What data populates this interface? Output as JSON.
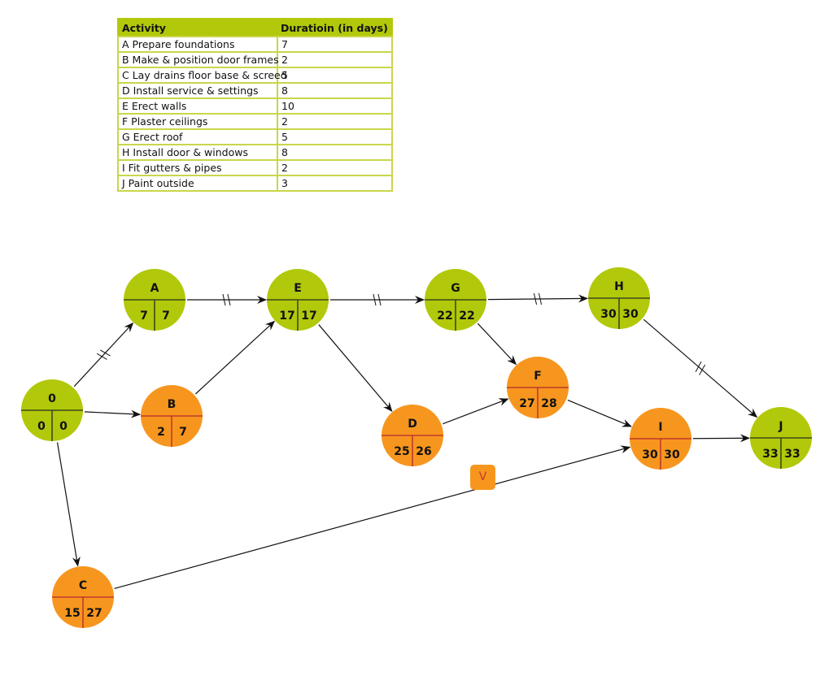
{
  "table": {
    "headers": [
      "Activity",
      "Duratioin (in days)"
    ],
    "rows": [
      {
        "activity": "A Prepare foundations",
        "duration": "7"
      },
      {
        "activity": "B Make & position door frames",
        "duration": "2"
      },
      {
        "activity": "C Lay drains floor base & screed",
        "duration": "5"
      },
      {
        "activity": "D Install service & settings",
        "duration": "8"
      },
      {
        "activity": "E Erect walls",
        "duration": "10"
      },
      {
        "activity": "F Plaster ceilings",
        "duration": "2"
      },
      {
        "activity": "G Erect roof",
        "duration": "5"
      },
      {
        "activity": "H Install door & windows",
        "duration": "8"
      },
      {
        "activity": "I Fit gutters & pipes",
        "duration": "2"
      },
      {
        "activity": "J Paint outside",
        "duration": "3"
      }
    ]
  },
  "colors": {
    "critical": "#b2c80a",
    "noncritical": "#f7961e",
    "critical_divider": "#3d4a1a",
    "noncritical_divider": "#c0392b",
    "arrow": "#111111"
  },
  "network": {
    "nodes": [
      {
        "id": "0",
        "label": "0",
        "eet": "0",
        "let": "0",
        "critical": true
      },
      {
        "id": "A",
        "label": "A",
        "eet": "7",
        "let": "7",
        "critical": true
      },
      {
        "id": "B",
        "label": "B",
        "eet": "2",
        "let": "7",
        "critical": false
      },
      {
        "id": "C",
        "label": "C",
        "eet": "15",
        "let": "27",
        "critical": false
      },
      {
        "id": "E",
        "label": "E",
        "eet": "17",
        "let": "17",
        "critical": true
      },
      {
        "id": "D",
        "label": "D",
        "eet": "25",
        "let": "26",
        "critical": false
      },
      {
        "id": "G",
        "label": "G",
        "eet": "22",
        "let": "22",
        "critical": true
      },
      {
        "id": "F",
        "label": "F",
        "eet": "27",
        "let": "28",
        "critical": false
      },
      {
        "id": "H",
        "label": "H",
        "eet": "30",
        "let": "30",
        "critical": true
      },
      {
        "id": "I",
        "label": "I",
        "eet": "30",
        "let": "30",
        "critical": false
      },
      {
        "id": "J",
        "label": "J",
        "eet": "33",
        "let": "33",
        "critical": true
      }
    ],
    "edges": [
      {
        "from": "0",
        "to": "A",
        "critical": true
      },
      {
        "from": "0",
        "to": "B",
        "critical": false
      },
      {
        "from": "0",
        "to": "C",
        "critical": false
      },
      {
        "from": "A",
        "to": "E",
        "critical": true
      },
      {
        "from": "B",
        "to": "E",
        "critical": false
      },
      {
        "from": "E",
        "to": "G",
        "critical": true
      },
      {
        "from": "E",
        "to": "D",
        "critical": false
      },
      {
        "from": "G",
        "to": "H",
        "critical": true
      },
      {
        "from": "G",
        "to": "F",
        "critical": false
      },
      {
        "from": "D",
        "to": "F",
        "critical": false
      },
      {
        "from": "F",
        "to": "I",
        "critical": false
      },
      {
        "from": "H",
        "to": "J",
        "critical": true
      },
      {
        "from": "I",
        "to": "J",
        "critical": false
      },
      {
        "from": "C",
        "to": "I",
        "critical": false
      }
    ]
  },
  "marker": {
    "label": "V"
  }
}
